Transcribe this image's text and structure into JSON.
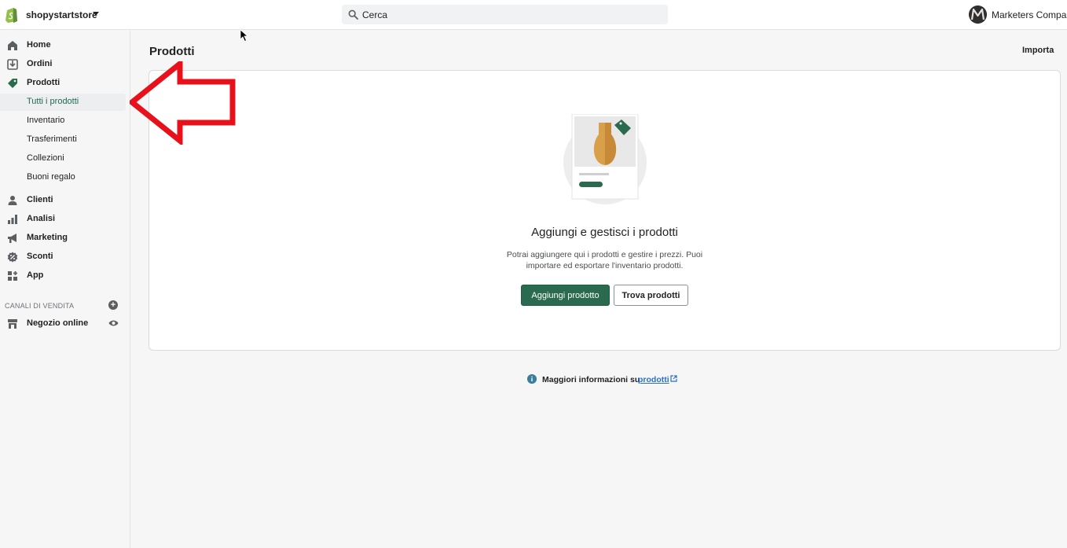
{
  "topbar": {
    "store_name": "shopystartstore",
    "search_placeholder": "Cerca",
    "account_name": "Marketers Company",
    "avatar_letter": "M"
  },
  "sidebar": {
    "items": [
      {
        "label": "Home",
        "icon": "home-icon"
      },
      {
        "label": "Ordini",
        "icon": "orders-icon"
      },
      {
        "label": "Prodotti",
        "icon": "tag-icon"
      }
    ],
    "sub_items": [
      {
        "label": "Tutti i prodotti",
        "active": true
      },
      {
        "label": "Inventario"
      },
      {
        "label": "Trasferimenti"
      },
      {
        "label": "Collezioni"
      },
      {
        "label": "Buoni regalo"
      }
    ],
    "items2": [
      {
        "label": "Clienti",
        "icon": "person-icon"
      },
      {
        "label": "Analisi",
        "icon": "bar-chart-icon"
      },
      {
        "label": "Marketing",
        "icon": "megaphone-icon"
      },
      {
        "label": "Sconti",
        "icon": "discount-icon"
      },
      {
        "label": "App",
        "icon": "apps-icon"
      }
    ],
    "sales_channels_title": "CANALI DI VENDITA",
    "online_store": "Negozio online"
  },
  "main": {
    "title": "Prodotti",
    "import_label": "Importa",
    "empty_state": {
      "title": "Aggiungi e gestisci i prodotti",
      "description_line1": "Potrai aggiungere qui i prodotti e gestire i prezzi. Puoi",
      "description_line2": "importare ed esportare l'inventario prodotti.",
      "primary_button": "Aggiungi prodotto",
      "secondary_button": "Trova prodotti"
    },
    "footer": {
      "text": "Maggiori informazioni su",
      "link": "prodotti"
    }
  },
  "colors": {
    "accent_green": "#2a6b4f",
    "annotation_red": "#e8101a",
    "link_blue": "#2c6ecb"
  }
}
